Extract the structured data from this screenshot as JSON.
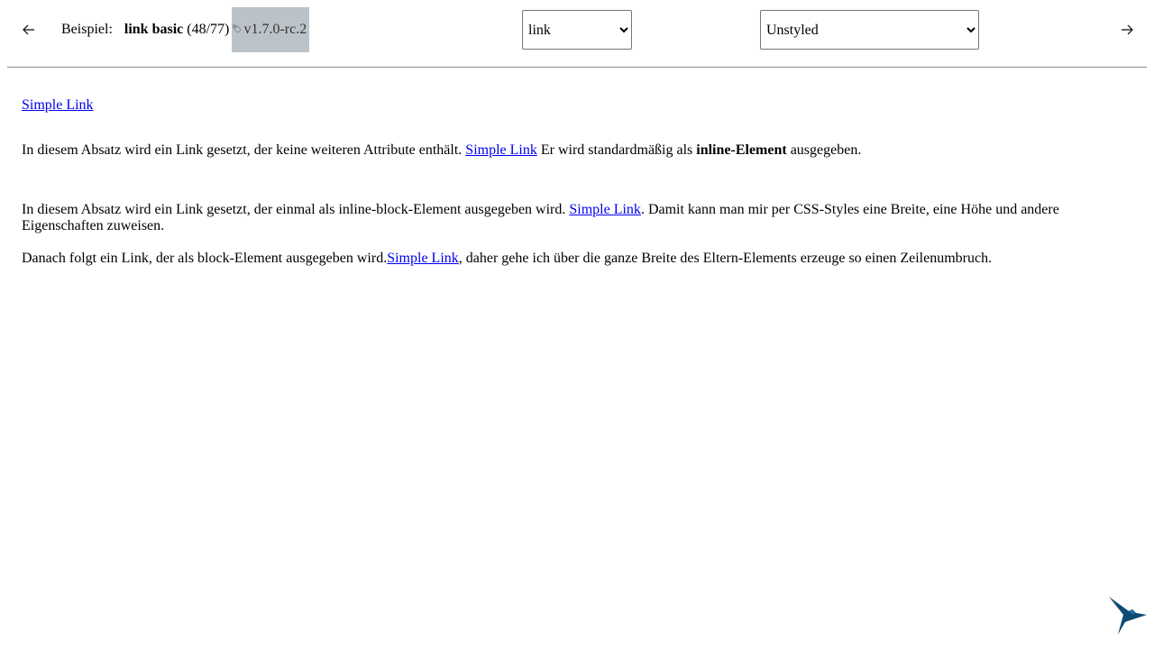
{
  "nav": {
    "prev_arrow": "←",
    "next_arrow": "→"
  },
  "example": {
    "label": "Beispiel:",
    "name": "link basic",
    "count": "(48/77)"
  },
  "version": {
    "icon": "tag-icon",
    "text": "v1.7.0-rc.2"
  },
  "element_select": {
    "selected": "link"
  },
  "style_select": {
    "selected": "Unstyled"
  },
  "content": {
    "link_text": "Simple Link",
    "p1_before": "In diesem Absatz wird ein Link gesetzt, der keine weiteren Attribute enthält. ",
    "p1_middle": " Er wird standardmäßig als ",
    "p1_bold": "inline-Element",
    "p1_after": " ausgegeben.",
    "p2_before": "In diesem Absatz wird ein Link gesetzt, der einmal als inline-block-Element ausgegeben wird. ",
    "p2_after": ". Damit kann man mir per CSS-Styles eine Breite, eine Höhe und andere Eigenschaften zuweisen.",
    "p3_before": "Danach folgt ein Link, der als block-Element ausgegeben wird.",
    "p3_after": ", daher gehe ich über die ganze Breite des Eltern-Elements erzeuge so einen Zeilenumbruch."
  },
  "colors": {
    "link": "#0000ee",
    "badge_bg": "#bcc3c8",
    "logo": "#0c4a73"
  },
  "logo": {
    "icon": "hummingbird-logo-icon"
  }
}
